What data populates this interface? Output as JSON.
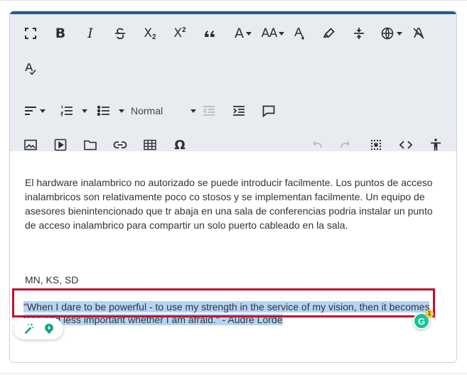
{
  "toolbar": {
    "format_select_value": "Normal",
    "buttons": [
      "fullscreen-icon",
      "bold-icon",
      "italic-icon",
      "strikethrough-icon",
      "subscript-icon",
      "superscript-icon",
      "blockquote-icon",
      "font-color-icon",
      "font-size-icon",
      "fill-color-icon",
      "highlight-icon",
      "line-height-icon",
      "language-icon",
      "clear-formatting-icon",
      "spellcheck-icon",
      "align-icon",
      "ordered-list-icon",
      "unordered-list-icon",
      "outdent-icon",
      "indent-icon",
      "comment-icon",
      "image-icon",
      "video-icon",
      "folder-icon",
      "link-icon",
      "table-icon",
      "special-characters-icon",
      "undo-icon",
      "redo-icon",
      "select-all-icon",
      "code-view-icon",
      "accessibility-icon"
    ],
    "subscript_label": "X",
    "subscript_sub": "2",
    "superscript_label": "X",
    "superscript_sup": "2",
    "bold_label": "B",
    "italic_label": "I",
    "font_color_label": "A",
    "font_size_label": "AA",
    "special_char_label": "Ω"
  },
  "content": {
    "paragraph": "El hardware inalambrico no autorizado se puede introducir facilmente. Los puntos de acceso inalambricos son relativamente poco co stosos y se implementan facilmente. Un equipo de asesores bienintencionado que tr abaja en una sala de conferencias podria instalar un punto de acceso inalambrico para compartir un solo puerto cableado en la sala.",
    "states": "MN, KS, SD",
    "quote": "\"When I dare to be powerful - to use my strength in the service of my vision, then it becomes less and less important whether I am afraid.\" - Audre Lorde"
  },
  "grammarly": {
    "letter": "G",
    "count": "1"
  },
  "colors": {
    "accent": "#1e5f98",
    "toolbar_bg": "#e8ecf0",
    "selection": "#b5d4f7",
    "highlight_border": "#c3102a",
    "grammarly": "#15c39a"
  }
}
